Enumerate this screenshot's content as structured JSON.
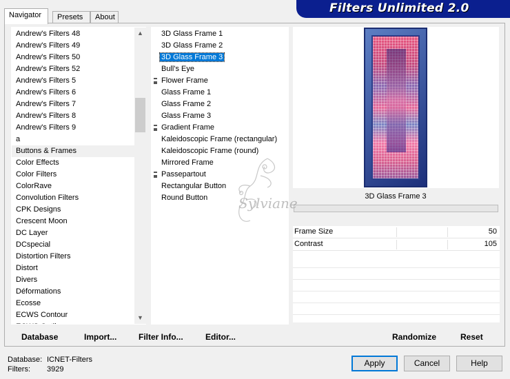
{
  "header": {
    "title": "Filters Unlimited 2.0"
  },
  "tabs": [
    {
      "label": "Navigator",
      "active": true
    },
    {
      "label": "Presets",
      "active": false
    },
    {
      "label": "About",
      "active": false
    }
  ],
  "categories": [
    "Andrew's Filters 48",
    "Andrew's Filters 49",
    "Andrew's Filters 50",
    "Andrew's Filters 52",
    "Andrew's Filters 5",
    "Andrew's Filters 6",
    "Andrew's Filters 7",
    "Andrew's Filters 8",
    "Andrew's Filters 9",
    "a",
    "Buttons & Frames",
    "Color Effects",
    "Color Filters",
    "ColorRave",
    "Convolution Filters",
    "CPK Designs",
    "Crescent Moon",
    "DC Layer",
    "DCspecial",
    "Distortion Filters",
    "Distort",
    "Divers",
    "Déformations",
    "Ecosse",
    "ECWS Contour",
    "ECWS Outline"
  ],
  "selected_category": "Buttons & Frames",
  "filters": [
    {
      "label": "3D Glass Frame 1",
      "group": false
    },
    {
      "label": "3D Glass Frame 2",
      "group": false
    },
    {
      "label": "3D Glass Frame 3",
      "group": false,
      "selected": true
    },
    {
      "label": "Bull's Eye",
      "group": false
    },
    {
      "label": "Flower Frame",
      "group": true
    },
    {
      "label": "Glass Frame 1",
      "group": false
    },
    {
      "label": "Glass Frame 2",
      "group": false
    },
    {
      "label": "Glass Frame 3",
      "group": false
    },
    {
      "label": "Gradient Frame",
      "group": true
    },
    {
      "label": "Kaleidoscopic Frame (rectangular)",
      "group": false
    },
    {
      "label": "Kaleidoscopic Frame (round)",
      "group": false
    },
    {
      "label": "Mirrored Frame",
      "group": false
    },
    {
      "label": "Passepartout",
      "group": true
    },
    {
      "label": "Rectangular Button",
      "group": false
    },
    {
      "label": "Round Button",
      "group": false
    }
  ],
  "preview": {
    "filter_name": "3D Glass Frame 3",
    "watermark": "Sylviane"
  },
  "params": [
    {
      "name": "Frame Size",
      "value": "50"
    },
    {
      "name": "Contrast",
      "value": "105"
    }
  ],
  "toolbar": {
    "database": "Database",
    "import": "Import...",
    "filter_info": "Filter Info...",
    "editor": "Editor...",
    "randomize": "Randomize",
    "reset": "Reset"
  },
  "footer": {
    "database_label": "Database:",
    "database_value": "ICNET-Filters",
    "filters_label": "Filters:",
    "filters_value": "3929",
    "apply": "Apply",
    "cancel": "Cancel",
    "help": "Help"
  },
  "colors": {
    "banner": "#0b1f8f",
    "selection": "#0078d7"
  }
}
